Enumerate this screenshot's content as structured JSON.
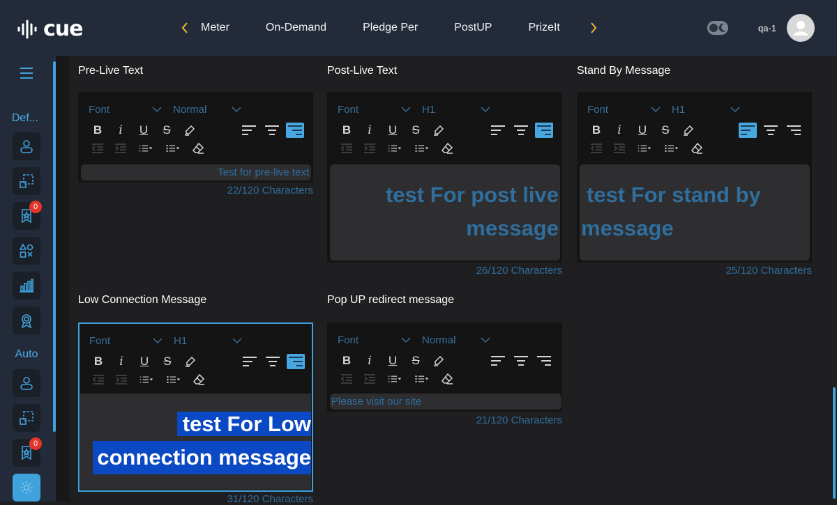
{
  "header": {
    "logo_text": "cue",
    "nav": [
      "Meter",
      "On-Demand",
      "Pledge Per",
      "PostUP",
      "PrizeIt"
    ],
    "user": "qa-1",
    "accent": "#f5b82e"
  },
  "sidebar": {
    "group1_label": "Def...",
    "group2_label": "Auto",
    "badge1": "0",
    "badge2": "0",
    "accent": "#3fa2dc"
  },
  "sections": {
    "pre_live": {
      "title": "Pre-Live Text",
      "font_label": "Font",
      "size_label": "Normal",
      "text": "Test for pre-live text",
      "counter": "22/120 Characters"
    },
    "post_live": {
      "title": "Post-Live Text",
      "font_label": "Font",
      "size_label": "H1",
      "text_line1": "test For post live",
      "text_line2": "message",
      "counter": "26/120 Characters"
    },
    "stand_by": {
      "title": "Stand By Message",
      "font_label": "Font",
      "size_label": "H1",
      "text_line1": "test For stand by",
      "text_line2": "message",
      "counter": "25/120 Characters"
    },
    "low_connection": {
      "title": "Low Connection Message",
      "font_label": "Font",
      "size_label": "H1",
      "text_line1": "test For Low",
      "text_line2": "connection message",
      "counter": "31/120 Characters"
    },
    "popup_redirect": {
      "title": "Pop UP redirect message",
      "font_label": "Font",
      "size_label": "Normal",
      "text": "Please visit our site",
      "counter": "21/120 Characters"
    }
  }
}
